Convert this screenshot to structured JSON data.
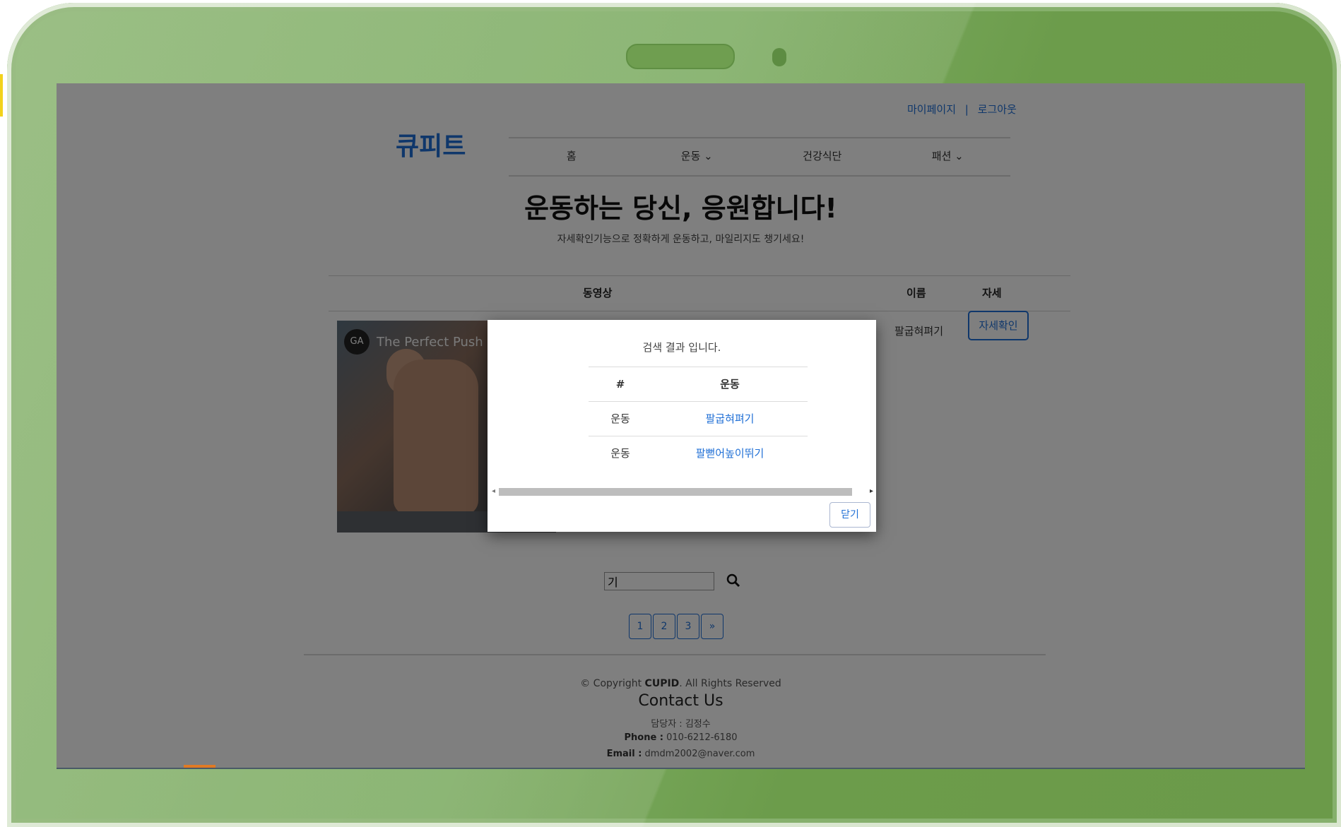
{
  "header": {
    "mypage": "마이페이지",
    "separator": "|",
    "logout": "로그아웃",
    "logo": "큐피트",
    "nav": [
      "홈",
      "운동 ⌄",
      "건강식단",
      "패션 ⌄"
    ]
  },
  "hero": {
    "title": "운동하는 당신, 응원합니다!",
    "subtitle": "자세확인기능으로 정확하게 운동하고, 마일리지도 챙기세요!"
  },
  "table": {
    "col_video": "동영상",
    "col_name": "이름",
    "col_detail": "자세",
    "row": {
      "video_title": "The Perfect Push Up",
      "video_logo": "GA",
      "name": "팔굽혀펴기",
      "button": "자세확인"
    }
  },
  "search": {
    "value": "기"
  },
  "pagination": [
    "1",
    "2",
    "3",
    "»"
  ],
  "footer": {
    "copyright_prefix": "© Copyright ",
    "copyright_brand": "CUPID",
    "copyright_suffix": ". All Rights Reserved",
    "contact_title": "Contact Us",
    "manager": "담당자 : 김정수",
    "phone_label": "Phone :",
    "phone": " 010-6212-6180",
    "email_label": "Email :",
    "email": " dmdm2002@naver.com"
  },
  "modal": {
    "title": "검색 결과 입니다.",
    "headers": [
      "#",
      "운동"
    ],
    "rows": [
      {
        "type": "운동",
        "name": "팔굽혀펴기"
      },
      {
        "type": "운동",
        "name": "팔뻗어높이뛰기"
      }
    ],
    "close": "닫기"
  },
  "colors": {
    "accent": "#1f6fd6",
    "frame_green": "#6b9a49"
  }
}
